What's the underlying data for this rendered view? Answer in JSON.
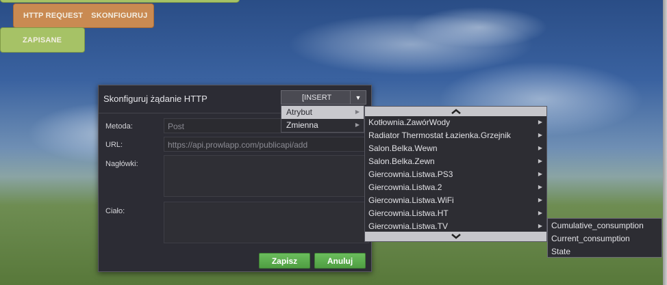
{
  "blocks": {
    "http_request": "HTTP REQUEST",
    "configure": "SKONFIGURUJ",
    "saved": "ZAPISANE"
  },
  "dialog": {
    "title": "Skonfiguruj żądanie HTTP",
    "insert_label": "[INSERT",
    "method_label": "Metoda:",
    "method_value": "Post",
    "url_label": "URL:",
    "url_value": "https://api.prowlapp.com/publicapi/add",
    "headers_label": "Nagłówki:",
    "body_label": "Ciało:",
    "save_button": "Zapisz",
    "cancel_button": "Anuluj"
  },
  "insert_menu": {
    "items": [
      "Atrybut",
      "Zmienna"
    ],
    "active_index": 0
  },
  "attribute_menu": {
    "items": [
      "Kotłownia.ZawórWody",
      "Radiator Thermostat Łazienka.Grzejnik",
      "Salon.Belka.Wewn",
      "Salon.Belka.Zewn",
      "Giercownia.Listwa.PS3",
      "Giercownia.Listwa.2",
      "Giercownia.Listwa.WiFi",
      "Giercownia.Listwa.HT",
      "Giercownia.Listwa.TV"
    ]
  },
  "submenu": {
    "items": [
      "Cumulative_consumption",
      "Current_consumption",
      "State"
    ]
  },
  "colors": {
    "accent_green": "#5aaa4c",
    "block_orange": "#c98a52",
    "block_green": "#a6c266",
    "dialog_bg": "#2c2c34"
  }
}
